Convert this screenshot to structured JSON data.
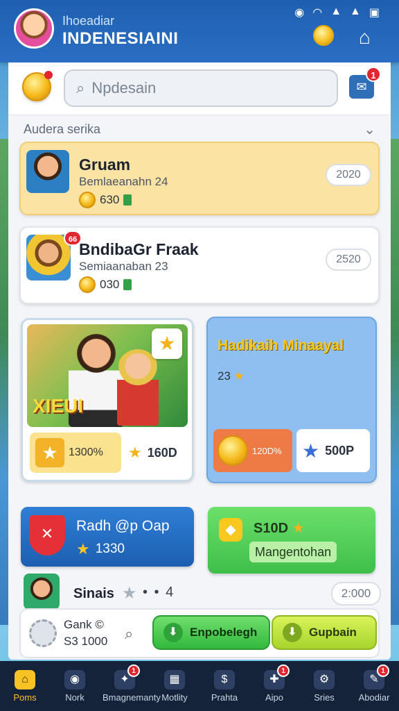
{
  "header": {
    "subtitle": "Ihoeadiar",
    "title": "INDENESIAINI",
    "status_icons": [
      "record-icon",
      "wifi-icon",
      "signal-icon",
      "signal-icon",
      "battery-icon"
    ]
  },
  "search": {
    "placeholder": "Npdesain",
    "message_badge": "1"
  },
  "section": {
    "title": "Audera serika",
    "chevron": "⌄"
  },
  "cards": [
    {
      "name": "Gruam",
      "sub": "Bemlaeanahn 24",
      "amount": "630",
      "pill": "2020"
    },
    {
      "name": "BndibaGr Fraak",
      "sub": "Semiaanaban 23",
      "amount": "030",
      "pill": "2520",
      "badge": "66"
    }
  ],
  "promo_left": {
    "title": "XIEUI",
    "reward_value": "1300%",
    "stars_value": "160D"
  },
  "promo_right": {
    "title": "Hadikaih Minaayal",
    "count": "23",
    "coin_label": "120D%",
    "sb_label": "500P"
  },
  "action_left": {
    "title": "Radh @p Oap",
    "value": "1330"
  },
  "action_right": {
    "title": "S10D",
    "label": "Mangentohan"
  },
  "last_row": {
    "name": "Sinais",
    "dots": "• • 4",
    "pill": "2:000"
  },
  "bottom_card": {
    "name": "Gank ©",
    "value": "S3 1000",
    "btn_primary": "Enpobelegh",
    "btn_secondary": "Gupbain"
  },
  "bottom_nav": [
    {
      "label": "Poms",
      "icon": "home-icon",
      "active": true
    },
    {
      "label": "Nork",
      "icon": "camera-icon"
    },
    {
      "label": "Bmagnemanty",
      "icon": "map-icon",
      "badge": "1"
    },
    {
      "label": "Motlity",
      "icon": "grid-icon"
    },
    {
      "label": "Prahta",
      "icon": "coin-icon"
    },
    {
      "label": "Aipo",
      "icon": "puzzle-icon",
      "badge": "1"
    },
    {
      "label": "Sries",
      "icon": "settings-icon"
    },
    {
      "label": "Abodiar",
      "icon": "chat-icon",
      "badge": "1"
    }
  ],
  "colors": {
    "header": "#1f5fb0",
    "accent_gold": "#f7c224",
    "green": "#3fbf4a",
    "blue": "#1c5fb1",
    "nav_bg": "#15233a"
  }
}
